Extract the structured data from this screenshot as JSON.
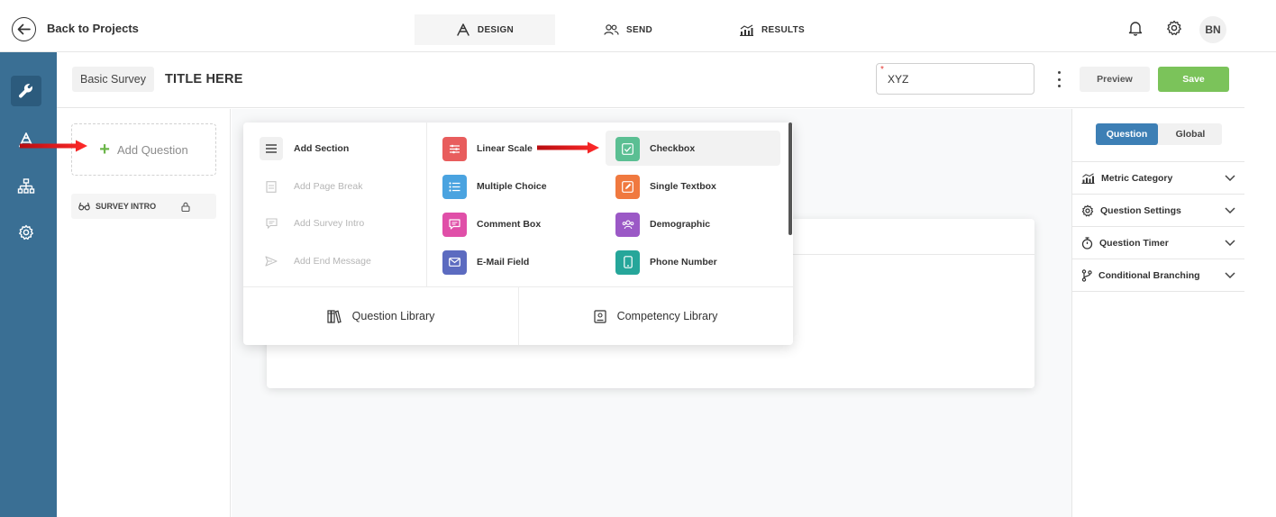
{
  "header": {
    "back_label": "Back to Projects",
    "tabs": [
      {
        "label": "DESIGN",
        "icon": "design-icon",
        "active": true
      },
      {
        "label": "SEND",
        "icon": "users-icon",
        "active": false
      },
      {
        "label": "RESULTS",
        "icon": "results-chart-icon",
        "active": false
      }
    ],
    "avatar_initials": "BN"
  },
  "sidebar": {
    "items": [
      {
        "icon": "wrench-icon",
        "active": true
      },
      {
        "icon": "design-icon",
        "active": false
      },
      {
        "icon": "hierarchy-icon",
        "active": false
      },
      {
        "icon": "gear-icon",
        "active": false
      }
    ]
  },
  "survey": {
    "type_label": "Basic Survey",
    "title": "TITLE HERE",
    "name_value": "XYZ",
    "required_mark": "*",
    "preview_label": "Preview",
    "save_label": "Save"
  },
  "outline": {
    "add_question_label": "Add Question",
    "intro_label": "SURVEY INTRO"
  },
  "add_menu": {
    "structure_items": [
      {
        "label": "Add Section",
        "enabled": true
      },
      {
        "label": "Add Page Break",
        "enabled": false
      },
      {
        "label": "Add Survey Intro",
        "enabled": false
      },
      {
        "label": "Add End Message",
        "enabled": false
      }
    ],
    "question_types": [
      {
        "label": "Linear Scale",
        "color": "#e85d5d"
      },
      {
        "label": "Checkbox",
        "color": "#5bbf93",
        "highlighted": true
      },
      {
        "label": "Multiple Choice",
        "color": "#4aa3e0"
      },
      {
        "label": "Single Textbox",
        "color": "#f0793f"
      },
      {
        "label": "Comment Box",
        "color": "#e04fa8"
      },
      {
        "label": "Demographic",
        "color": "#9b59c6"
      },
      {
        "label": "E-Mail Field",
        "color": "#5c6bc0"
      },
      {
        "label": "Phone Number",
        "color": "#26a69a"
      }
    ],
    "libraries": [
      {
        "label": "Question Library"
      },
      {
        "label": "Competency Library"
      }
    ]
  },
  "right_panel": {
    "segments": [
      {
        "label": "Question",
        "active": true
      },
      {
        "label": "Global",
        "active": false
      }
    ],
    "sections": [
      {
        "label": "Metric Category",
        "icon": "metric-icon"
      },
      {
        "label": "Question Settings",
        "icon": "settings-icon"
      },
      {
        "label": "Question Timer",
        "icon": "timer-icon"
      },
      {
        "label": "Conditional Branching",
        "icon": "branch-icon"
      }
    ]
  },
  "colors": {
    "sidebar": "#3a6f94",
    "accent_blue": "#3d7fb5",
    "save_green": "#7bc35a",
    "annotation_arrow": "#e8141a"
  }
}
